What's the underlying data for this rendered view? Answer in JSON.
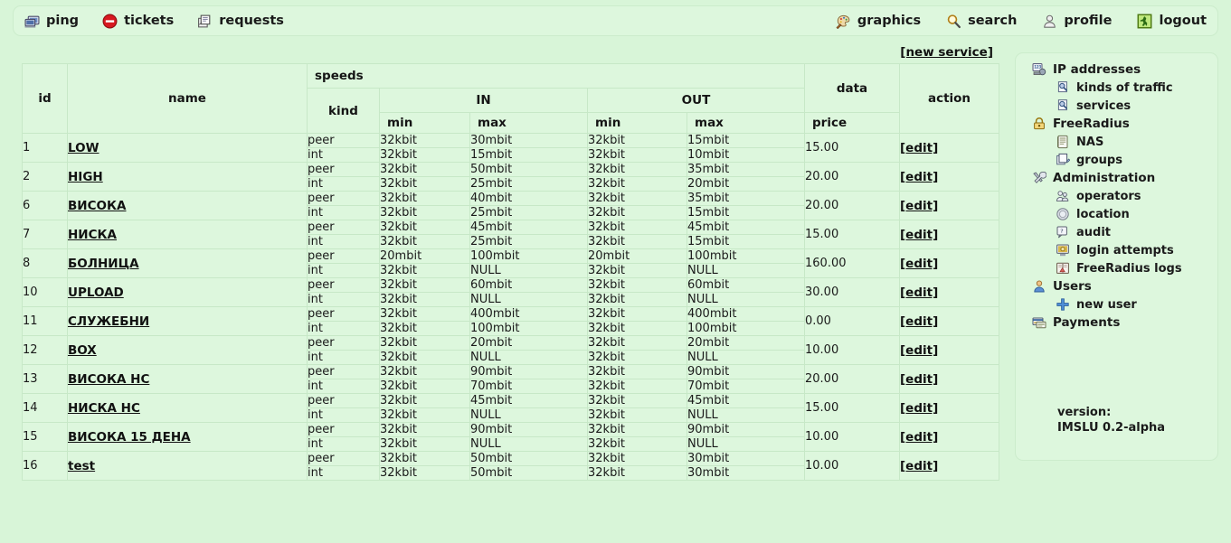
{
  "nav": {
    "left": [
      {
        "label": "ping",
        "icon": "computer-icon"
      },
      {
        "label": "tickets",
        "icon": "no-entry-icon"
      },
      {
        "label": "requests",
        "icon": "documents-icon"
      }
    ],
    "right": [
      {
        "label": "graphics",
        "icon": "palette-icon"
      },
      {
        "label": "search",
        "icon": "magnifier-icon"
      },
      {
        "label": "profile",
        "icon": "person-icon"
      },
      {
        "label": "logout",
        "icon": "exit-door-icon"
      }
    ]
  },
  "table": {
    "new_service_label": "[new service]",
    "headers": {
      "id": "id",
      "name": "name",
      "speeds": "speeds",
      "kind": "kind",
      "in": "IN",
      "out": "OUT",
      "min": "min",
      "max": "max",
      "data": "data",
      "price": "price",
      "action": "action"
    },
    "edit_label": "[edit]",
    "rows": [
      {
        "id": "1",
        "name": "LOW",
        "price": "15.00",
        "action": "[edit]",
        "lines": [
          {
            "kind": "peer",
            "in_min": "32kbit",
            "in_max": "30mbit",
            "out_min": "32kbit",
            "out_max": "15mbit"
          },
          {
            "kind": "int",
            "in_min": "32kbit",
            "in_max": "15mbit",
            "out_min": "32kbit",
            "out_max": "10mbit"
          }
        ]
      },
      {
        "id": "2",
        "name": "HIGH",
        "price": "20.00",
        "action": "[edit]",
        "lines": [
          {
            "kind": "peer",
            "in_min": "32kbit",
            "in_max": "50mbit",
            "out_min": "32kbit",
            "out_max": "35mbit"
          },
          {
            "kind": "int",
            "in_min": "32kbit",
            "in_max": "25mbit",
            "out_min": "32kbit",
            "out_max": "20mbit"
          }
        ]
      },
      {
        "id": "6",
        "name": "ВИСОКА",
        "price": "20.00",
        "action": "[edit]",
        "lines": [
          {
            "kind": "peer",
            "in_min": "32kbit",
            "in_max": "40mbit",
            "out_min": "32kbit",
            "out_max": "35mbit"
          },
          {
            "kind": "int",
            "in_min": "32kbit",
            "in_max": "25mbit",
            "out_min": "32kbit",
            "out_max": "15mbit"
          }
        ]
      },
      {
        "id": "7",
        "name": "НИСКА",
        "price": "15.00",
        "action": "[edit]",
        "lines": [
          {
            "kind": "peer",
            "in_min": "32kbit",
            "in_max": "45mbit",
            "out_min": "32kbit",
            "out_max": "45mbit"
          },
          {
            "kind": "int",
            "in_min": "32kbit",
            "in_max": "25mbit",
            "out_min": "32kbit",
            "out_max": "15mbit"
          }
        ]
      },
      {
        "id": "8",
        "name": "БОЛНИЦА",
        "price": "160.00",
        "action": "[edit]",
        "lines": [
          {
            "kind": "peer",
            "in_min": "20mbit",
            "in_max": "100mbit",
            "out_min": "20mbit",
            "out_max": "100mbit"
          },
          {
            "kind": "int",
            "in_min": "32kbit",
            "in_max": "NULL",
            "out_min": "32kbit",
            "out_max": "NULL"
          }
        ]
      },
      {
        "id": "10",
        "name": "UPLOAD",
        "price": "30.00",
        "action": "[edit]",
        "lines": [
          {
            "kind": "peer",
            "in_min": "32kbit",
            "in_max": "60mbit",
            "out_min": "32kbit",
            "out_max": "60mbit"
          },
          {
            "kind": "int",
            "in_min": "32kbit",
            "in_max": "NULL",
            "out_min": "32kbit",
            "out_max": "NULL"
          }
        ]
      },
      {
        "id": "11",
        "name": "СЛУЖЕБНИ",
        "price": "0.00",
        "action": "[edit]",
        "lines": [
          {
            "kind": "peer",
            "in_min": "32kbit",
            "in_max": "400mbit",
            "out_min": "32kbit",
            "out_max": "400mbit"
          },
          {
            "kind": "int",
            "in_min": "32kbit",
            "in_max": "100mbit",
            "out_min": "32kbit",
            "out_max": "100mbit"
          }
        ]
      },
      {
        "id": "12",
        "name": "BOX",
        "price": "10.00",
        "action": "[edit]",
        "lines": [
          {
            "kind": "peer",
            "in_min": "32kbit",
            "in_max": "20mbit",
            "out_min": "32kbit",
            "out_max": "20mbit"
          },
          {
            "kind": "int",
            "in_min": "32kbit",
            "in_max": "NULL",
            "out_min": "32kbit",
            "out_max": "NULL"
          }
        ]
      },
      {
        "id": "13",
        "name": "ВИСОКА НС",
        "price": "20.00",
        "action": "[edit]",
        "lines": [
          {
            "kind": "peer",
            "in_min": "32kbit",
            "in_max": "90mbit",
            "out_min": "32kbit",
            "out_max": "90mbit"
          },
          {
            "kind": "int",
            "in_min": "32kbit",
            "in_max": "70mbit",
            "out_min": "32kbit",
            "out_max": "70mbit"
          }
        ]
      },
      {
        "id": "14",
        "name": "НИСКА НС",
        "price": "15.00",
        "action": "[edit]",
        "lines": [
          {
            "kind": "peer",
            "in_min": "32kbit",
            "in_max": "45mbit",
            "out_min": "32kbit",
            "out_max": "45mbit"
          },
          {
            "kind": "int",
            "in_min": "32kbit",
            "in_max": "NULL",
            "out_min": "32kbit",
            "out_max": "NULL"
          }
        ]
      },
      {
        "id": "15",
        "name": "ВИСОКА 15 ДЕНА",
        "price": "10.00",
        "action": "[edit]",
        "lines": [
          {
            "kind": "peer",
            "in_min": "32kbit",
            "in_max": "90mbit",
            "out_min": "32kbit",
            "out_max": "90mbit"
          },
          {
            "kind": "int",
            "in_min": "32kbit",
            "in_max": "NULL",
            "out_min": "32kbit",
            "out_max": "NULL"
          }
        ]
      },
      {
        "id": "16",
        "name": "test",
        "price": "10.00",
        "action": "[edit]",
        "lines": [
          {
            "kind": "peer",
            "in_min": "32kbit",
            "in_max": "50mbit",
            "out_min": "32kbit",
            "out_max": "30mbit"
          },
          {
            "kind": "int",
            "in_min": "32kbit",
            "in_max": "50mbit",
            "out_min": "32kbit",
            "out_max": "30mbit"
          }
        ]
      }
    ]
  },
  "sidebar": {
    "items": [
      {
        "label": "IP addresses",
        "level": 1,
        "icon": "ip-addresses-icon"
      },
      {
        "label": "kinds of traffic",
        "level": 2,
        "icon": "traffic-kinds-icon"
      },
      {
        "label": "services",
        "level": 2,
        "icon": "services-icon"
      },
      {
        "label": "FreeRadius",
        "level": 1,
        "icon": "radius-lock-icon"
      },
      {
        "label": "NAS",
        "level": 2,
        "icon": "nas-icon"
      },
      {
        "label": "groups",
        "level": 2,
        "icon": "groups-icon"
      },
      {
        "label": "Administration",
        "level": 1,
        "icon": "tools-icon"
      },
      {
        "label": "operators",
        "level": 2,
        "icon": "operators-icon"
      },
      {
        "label": "location",
        "level": 2,
        "icon": "location-icon"
      },
      {
        "label": "audit",
        "level": 2,
        "icon": "audit-icon"
      },
      {
        "label": "login attempts",
        "level": 2,
        "icon": "login-attempts-icon"
      },
      {
        "label": "FreeRadius logs",
        "level": 2,
        "icon": "logs-book-icon"
      },
      {
        "label": "Users",
        "level": 1,
        "icon": "user-icon"
      },
      {
        "label": "new user",
        "level": 2,
        "icon": "plus-icon"
      },
      {
        "label": "Payments",
        "level": 1,
        "icon": "payments-card-icon"
      }
    ],
    "version_label": "version:",
    "version_value": "IMSLU 0.2-alpha"
  },
  "colors": {
    "page_bg": "#d8f5d8",
    "panel_bg": "#ddf7dd",
    "border": "#c7e8c7",
    "text": "#1a1a1a"
  }
}
